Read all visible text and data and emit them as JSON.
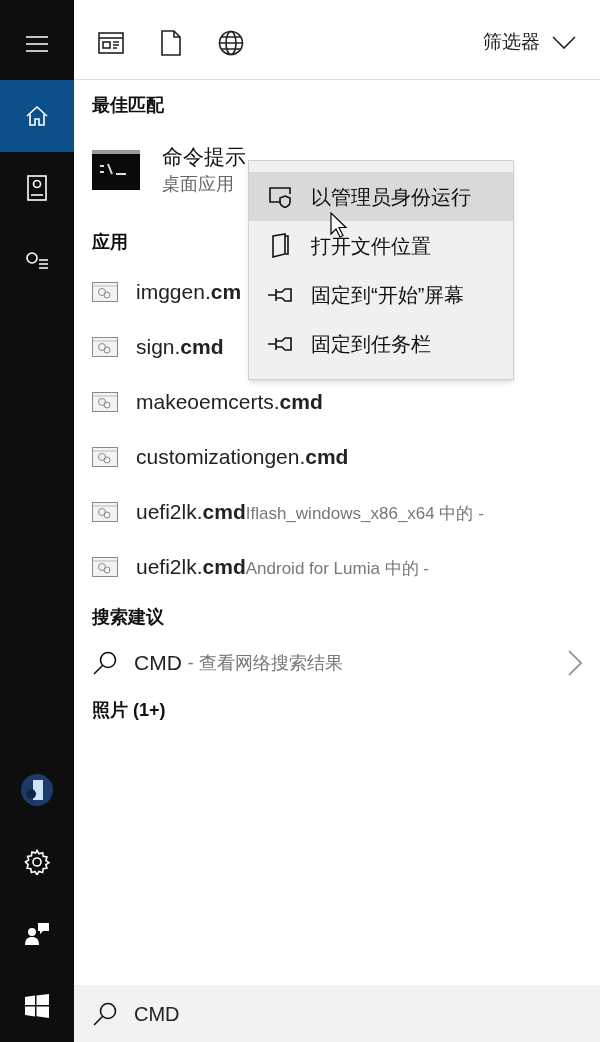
{
  "sidebar": {
    "top_items": [
      {
        "kind": "menu",
        "selected": false
      },
      {
        "kind": "home",
        "selected": true
      },
      {
        "kind": "notebook",
        "selected": false
      },
      {
        "kind": "interests",
        "selected": false
      }
    ],
    "bottom_items": [
      {
        "kind": "avatar",
        "selected": false
      },
      {
        "kind": "settings",
        "selected": false
      },
      {
        "kind": "feedback",
        "selected": false
      },
      {
        "kind": "start",
        "selected": false
      }
    ]
  },
  "toolbar": {
    "scopes": [
      {
        "kind": "apps"
      },
      {
        "kind": "documents"
      },
      {
        "kind": "web"
      }
    ],
    "filter": "筛选器"
  },
  "best_match": {
    "heading": "最佳匹配",
    "title": "命令提示",
    "subtitle": "桌面应用"
  },
  "apps": {
    "heading": "应用",
    "items": [
      {
        "name": "imggen.**cm**"
      },
      {
        "name": "sign.**cmd**"
      },
      {
        "name": "makeoemcerts.**cmd**"
      },
      {
        "name": "customizationgen.**cmd**"
      },
      {
        "name": "uefi2lk.**cmd**",
        "detail": "Iflash_windows_x86_x64 中的 -"
      },
      {
        "name": "uefi2lk.**cmd**",
        "detail": "Android for Lumia 中的 -"
      }
    ]
  },
  "suggestions": {
    "heading": "搜索建议",
    "items": [
      {
        "query": "CMD",
        "detail": "- 查看网络搜索结果"
      }
    ]
  },
  "photos": {
    "heading": "照片 (1+)"
  },
  "context_menu": {
    "items": [
      {
        "kind": "shield",
        "label": "以管理员身份运行",
        "selected": true
      },
      {
        "kind": "folder",
        "label": "打开文件位置",
        "selected": false
      },
      {
        "kind": "pin",
        "label": "固定到“开始”屏幕",
        "selected": false
      },
      {
        "kind": "pin",
        "label": "固定到任务栏",
        "selected": false
      }
    ]
  },
  "search": {
    "value": "CMD"
  }
}
